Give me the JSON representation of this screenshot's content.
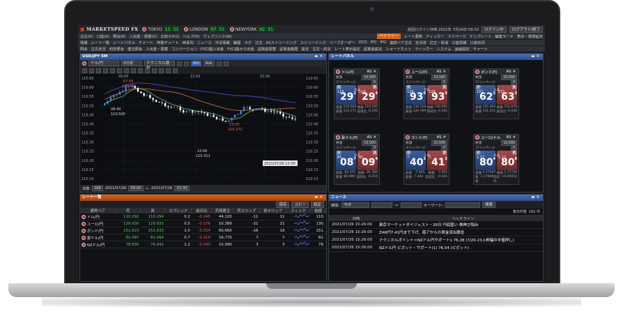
{
  "app": {
    "logo_main": "MARKETSPEED",
    "logo_fx": " FX",
    "markets": [
      {
        "name": "TOKYO",
        "time": "15 31"
      },
      {
        "name": "LONDON",
        "time": "07 31"
      },
      {
        "name": "NEWYORK",
        "time": "02 31"
      }
    ],
    "special_btn": "ペイフリー",
    "login_text": "前回ログイン日時  2021年 7月26日 09:32",
    "login_btn": "ログイン中",
    "layout_btn": "ログアウト/終了"
  },
  "menu1": [
    "注文(H)",
    "口座(A)",
    "照会(R)",
    "入出金・振替(D)",
    "お知らせ(I)",
    "ヘルプ(H)",
    "ウェブリンク(W)"
  ],
  "menu1_right": [
    "レート更新",
    "ティッカー",
    "マイページ",
    "テンプレート",
    "編集モード",
    "表示・環境設定"
  ],
  "menu2": [
    "情報",
    "レート一覧",
    "レートパネル",
    "チャート",
    "特殊チャート",
    "時系列",
    "ニュース",
    "市況情報",
    "範囲",
    "ラグ",
    "注文",
    "ASストリーミング",
    "ストリーミング",
    "リーブオーダー",
    "OCO",
    "IFD",
    "IFO",
    "連続ペア注文",
    "全決済",
    "訂正・取消",
    "口座情報",
    "口座状況"
  ],
  "menu3": [
    "照会",
    "注文状況",
    "約定照会",
    "建玉照会",
    "入出金・振替",
    "コンバージョン",
    "FX口座入出金",
    "FX口座から出金",
    "証拠金振替",
    "証拠金履歴",
    "設定",
    "注文・約定",
    "レート表示設定",
    "証拠金設定",
    "ショートカット",
    "ティッカー",
    "システム",
    "画面設定",
    "チャート"
  ],
  "chart": {
    "title": "USD/JPY 5M",
    "pair": "ドル/円",
    "interval": "5分足",
    "indicator": "テクニカル選択",
    "bid_ask": [
      "Bid",
      "Ask"
    ],
    "price_labels": [
      "110.65",
      "110.60",
      "110.55",
      "110.50",
      "110.45",
      "110.40",
      "110.35",
      "110.30",
      "110.25",
      "110.20",
      "110.15",
      "110.10"
    ],
    "right_labels": [
      "110.65",
      "110.60",
      "110.55",
      "110.50",
      "110.45",
      "110.40",
      "110.35",
      "110.30",
      "110.25",
      "110.20",
      "110.15",
      "110.10"
    ],
    "time_labels": [
      "09:00",
      "12:00",
      "15:00"
    ],
    "annot_high_time": "07:55",
    "annot_high": "110.584",
    "annot_low1_time": "08:40",
    "annot_low1": "110.500",
    "annot_mid_time": "13:25",
    "annot_mid": "110.372",
    "annot_low2_time": "12:00",
    "annot_low2": "110.311",
    "cursor_label": "2021/07/26 12:00",
    "footer_count_label": "本数",
    "footer_count": "168",
    "footer_from_date": "2021/07/26",
    "footer_from_time": "08:05",
    "footer_to_date": "2021/07/26",
    "footer_to_time": "15:30"
  },
  "rate_panel": {
    "title": "レートパネル",
    "tiles": [
      {
        "pair": "ドル/円",
        "as": "AS",
        "spread": "0.2",
        "qty_label": "数量",
        "qty": "10,000",
        "slip_label": "スリッページ",
        "slip": "0",
        "sell_small": "110.",
        "sell_big": "29",
        "sell_sup": "2",
        "buy_small": "110.",
        "buy_big": "29",
        "buy_sup": "4",
        "high_label": "高値",
        "high": "110.584",
        "low_label": "安値",
        "low": "110.171",
        "open_label": "始値",
        "open": "110.505",
        "chg_label": "前日比",
        "chg": "-0.192"
      },
      {
        "pair": "ユーロ/円",
        "as": "AS",
        "spread": "0.5",
        "qty_label": "数量",
        "qty": "10,000",
        "slip_label": "スリッページ",
        "slip": "0",
        "sell_small": "129.",
        "sell_big": "93",
        "sell_sup": "0",
        "buy_small": "129.",
        "buy_big": "93",
        "buy_sup": "5",
        "high_label": "高値",
        "high": "130.128",
        "low_label": "安値",
        "low": "129.769",
        "open_label": "始値",
        "open": "130.095",
        "chg_label": "前日比",
        "chg": "-0.162"
      },
      {
        "pair": "ポンド/円",
        "as": "AS",
        "spread": "1.0",
        "qty_label": "数量",
        "qty": "10,000",
        "slip_label": "スリッページ",
        "slip": "0",
        "sell_small": "151.",
        "sell_big": "62",
        "sell_sup": "3",
        "buy_small": "151.",
        "buy_big": "63",
        "buy_sup": "3",
        "high_label": "高値",
        "high": "151.904",
        "low_label": "安値",
        "low": "151.451",
        "open_label": "始値",
        "open": "151.878",
        "chg_label": "前日比",
        "chg": "-0.256"
      },
      {
        "pair": "豪ドル/円",
        "as": "AS",
        "spread": "0.7",
        "qty_label": "数量",
        "qty": "10,000",
        "slip_label": "スリッページ",
        "slip": "0",
        "sell_small": "81.",
        "sell_big": "08",
        "sell_sup": "7",
        "buy_small": "81.",
        "buy_big": "09",
        "buy_sup": "4",
        "high_label": "高値",
        "high": "81.471",
        "low_label": "安値",
        "low": "80.999",
        "open_label": "始値",
        "open": "81.366",
        "chg_label": "前日比",
        "chg": "-0.254"
      },
      {
        "pair": "ランド/円",
        "as": "AS",
        "spread": "1.0",
        "qty_label": "数量",
        "qty": "10,000",
        "slip_label": "スリッページ",
        "slip": "0",
        "sell_small": "7.",
        "sell_big": "40",
        "sell_sup": "3",
        "buy_small": "7.",
        "buy_big": "41",
        "buy_sup": "2",
        "high_label": "高値",
        "high": "7.465",
        "low_label": "安値",
        "low": "7.392",
        "open_label": "始値",
        "open": "7.452",
        "chg_label": "前日比",
        "chg": "-0.031"
      },
      {
        "pair": "ユーロ/ドル",
        "as": "AS",
        "spread": "0.4",
        "qty_label": "数量",
        "qty": "10,000",
        "slip_label": "スリッページ",
        "slip": "0",
        "sell_small": "1.17",
        "sell_big": "80",
        "sell_sup": "4",
        "buy_small": "1.17",
        "buy_big": "80",
        "buy_sup": "8",
        "high_label": "高値",
        "high": "1.17947",
        "low_label": "安値",
        "low": "1.17698",
        "open_label": "始値",
        "open": "1.17736",
        "chg_label": "前日比",
        "chg": "+0.00052"
      }
    ],
    "sell_label": "売",
    "buy_label": "買"
  },
  "rate_list": {
    "title": "レート一覧",
    "buttons": [
      "保存",
      "コピー",
      "設定"
    ],
    "headers": [
      "通貨ペア",
      "売",
      "買",
      "スプレッド",
      "前日比",
      "売買建玉",
      "売スワップ",
      "買スワップ",
      "ティック",
      "始値"
    ],
    "rows": [
      {
        "name": "ドル/円",
        "bid": "110.292",
        "ask": "110.294",
        "spread": "0.2",
        "chg": "-0.246",
        "vol": "44,120",
        "sswap": "-11",
        "bswap": "11",
        "open": "110."
      },
      {
        "name": "ユーロ/円",
        "bid": "129.930",
        "ask": "129.935",
        "spread": "0.5",
        "chg": "-0.176",
        "vol": "10,389",
        "sswap": "-21",
        "bswap": "21",
        "open": "130."
      },
      {
        "name": "ポンド/円",
        "bid": "151.623",
        "ask": "151.633",
        "spread": "1.0",
        "chg": "-0.334",
        "vol": "60,660",
        "sswap": "-16",
        "bswap": "16",
        "open": "151."
      },
      {
        "name": "豪ドル/円",
        "bid": "81.087",
        "ask": "81.094",
        "spread": "0.7",
        "chg": "-0.210",
        "vol": "18,770",
        "sswap": "7",
        "bswap": "7",
        "open": "81."
      },
      {
        "name": "NZドル/円",
        "bid": "76.830",
        "ask": "76.842",
        "spread": "1.2",
        "chg": "-0.290",
        "vol": "10,990",
        "sswap": "3",
        "bswap": "3",
        "open": "76."
      }
    ]
  },
  "news": {
    "title": "ニュース",
    "period_label": "期間:",
    "period_value": "今日",
    "tilde": "〜",
    "keyword_label": "キーワード:",
    "search_btn": "検索",
    "count_label": "表示件数",
    "count_value": "182 件",
    "col_date": "日時",
    "col_headline": "ヘッドライン",
    "items": [
      {
        "date": "2021/07/26 15:26:00",
        "headline": "東京マーケットダイジェスト・26日  円底堅い 株伸び悩み"
      },
      {
        "date": "2021/07/26 15:26:00",
        "headline": "ZAR円7.41円まで下げ、南アからの資金流出懸念"
      },
      {
        "date": "2021/07/26 15:26:00",
        "headline": "テクニカルポイント＝NZドル円サポート1  76.28  (7/20-23上昇幅の半値押し)"
      },
      {
        "date": "2021/07/26 15:26:00",
        "headline": "NZドル円 ビボット・サポート(1) 76.54 (ピボット)"
      }
    ]
  }
}
